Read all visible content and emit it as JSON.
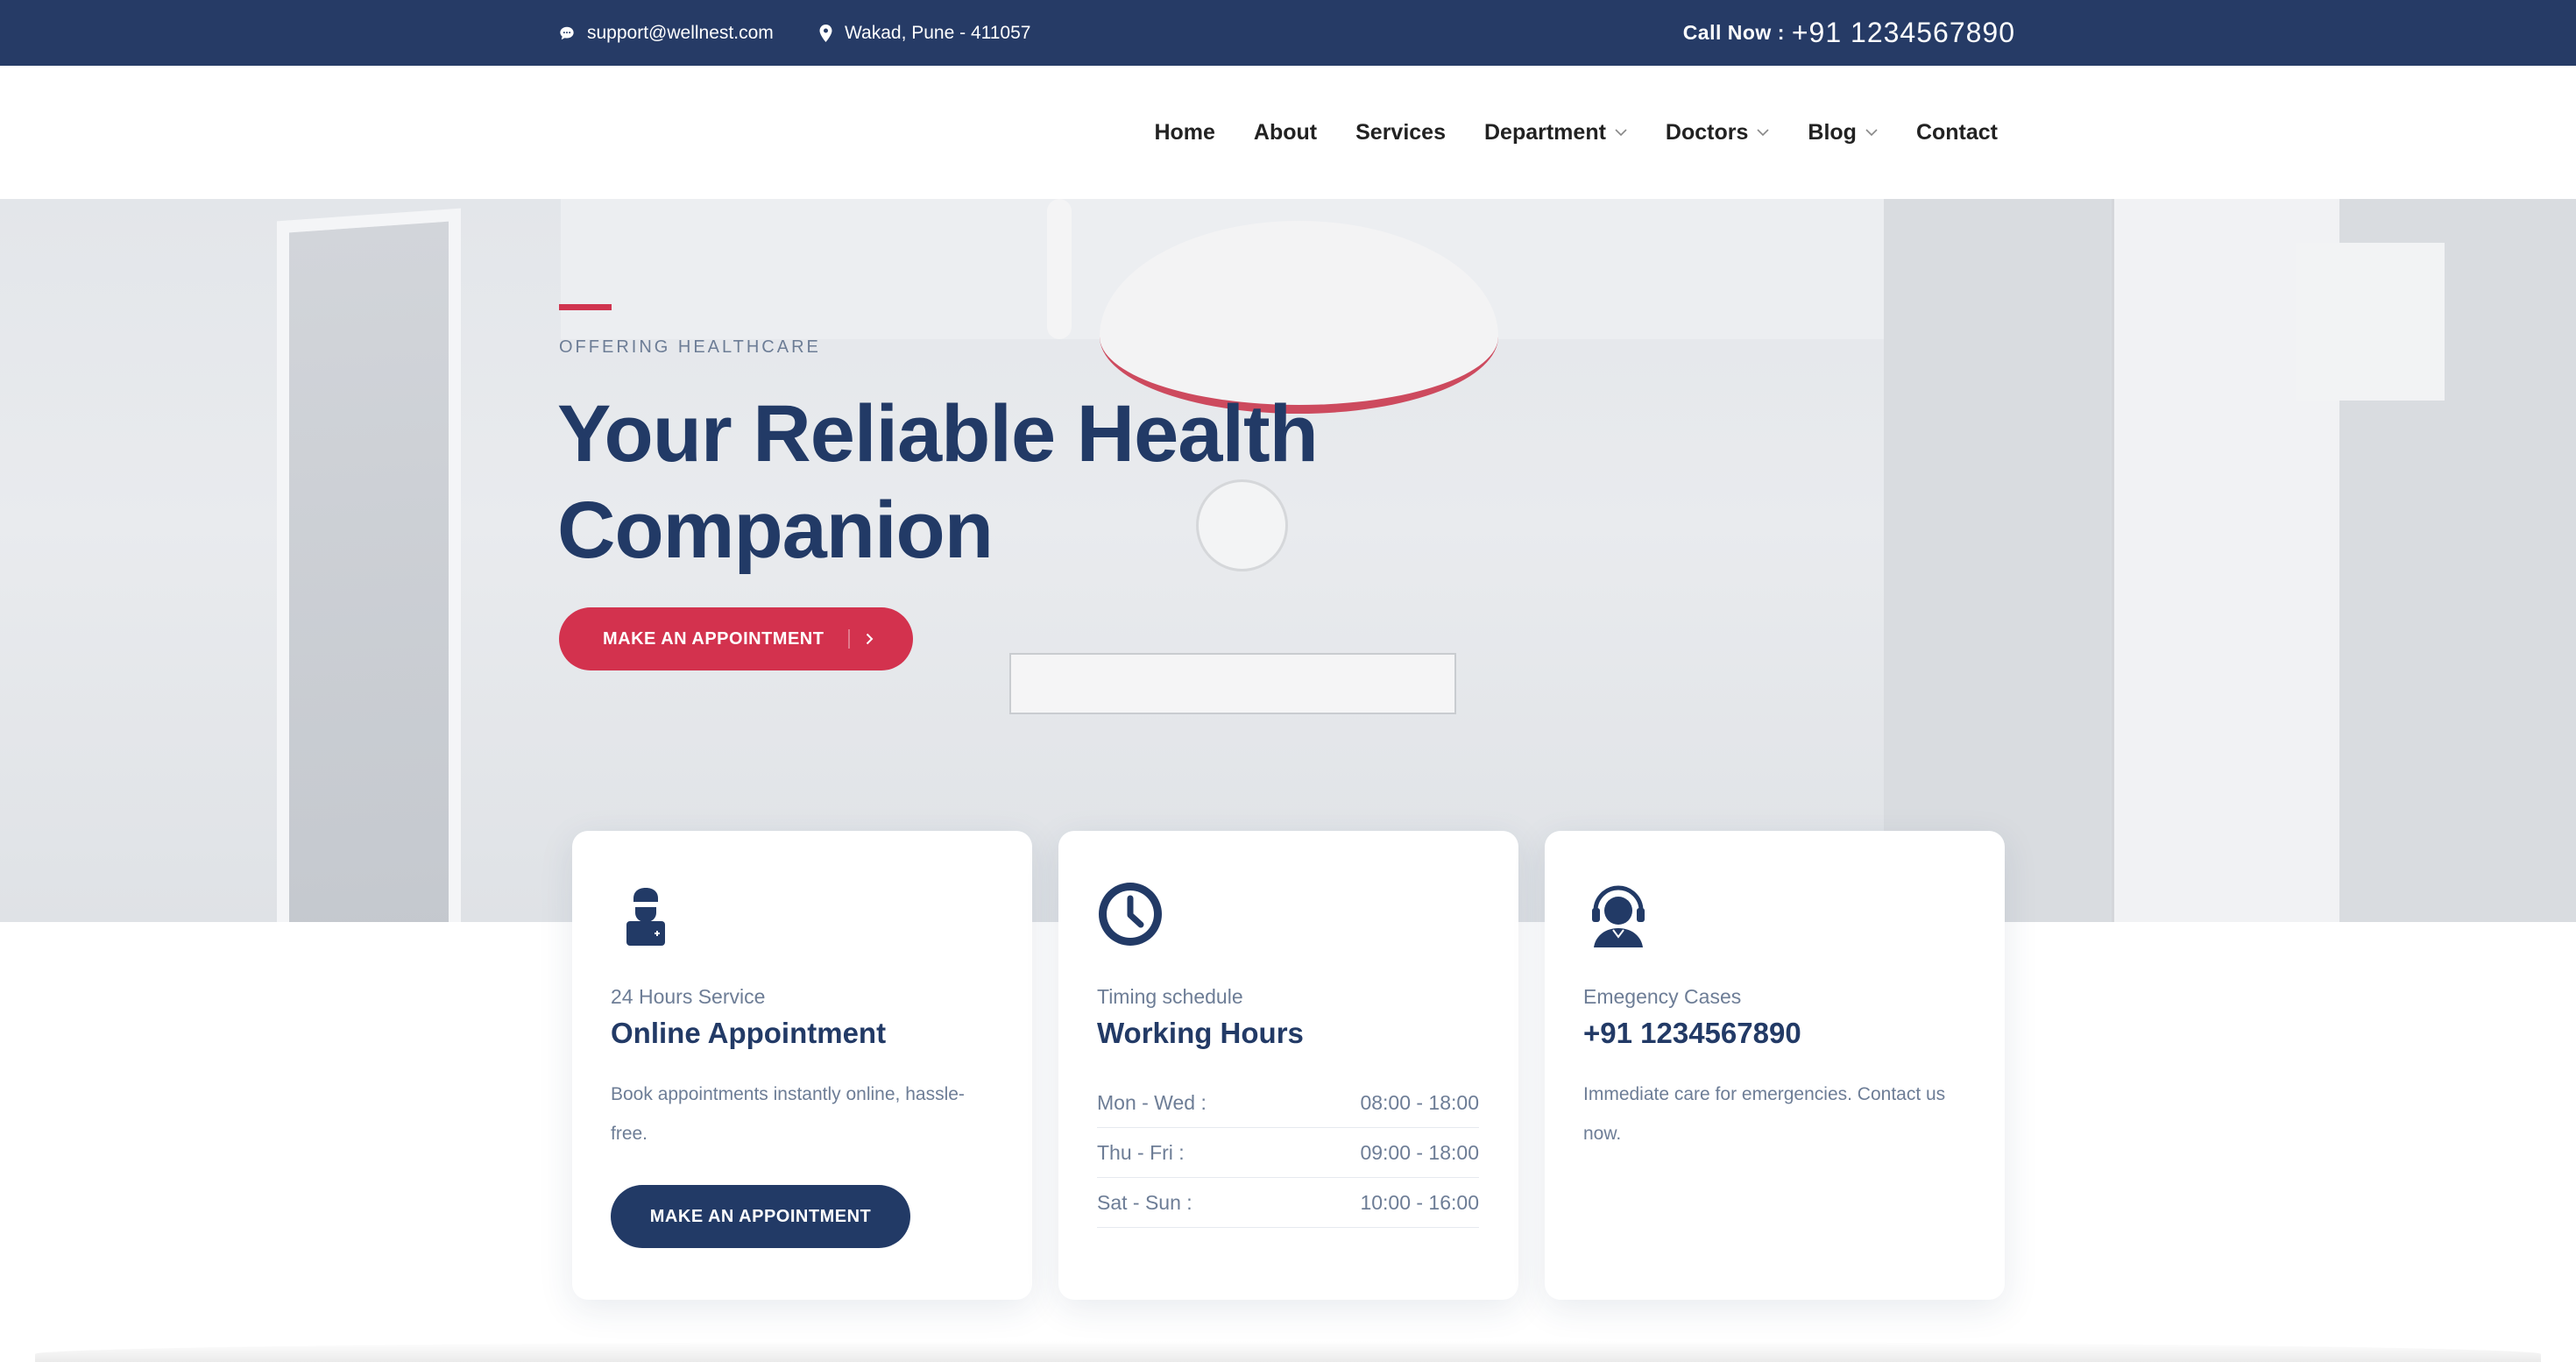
{
  "topbar": {
    "email": "support@wellnest.com",
    "address": "Wakad, Pune - 411057",
    "call_label": "Call Now :",
    "call_number": "+91 1234567890"
  },
  "nav": {
    "items": [
      {
        "label": "Home"
      },
      {
        "label": "About"
      },
      {
        "label": "Services"
      },
      {
        "label": "Department",
        "dropdown": true
      },
      {
        "label": "Doctors",
        "dropdown": true
      },
      {
        "label": "Blog",
        "dropdown": true
      },
      {
        "label": "Contact"
      }
    ]
  },
  "hero": {
    "kicker": "OFFERING HEALTHCARE",
    "title_line1": "Your Reliable Health",
    "title_line2": "Companion",
    "cta": "MAKE AN APPOINTMENT"
  },
  "cards": {
    "appointment": {
      "icon": "doctor-icon",
      "subtitle": "24 Hours Service",
      "title": "Online Appointment",
      "description": "Book appointments instantly online, hassle-free.",
      "button": "MAKE AN APPOINTMENT"
    },
    "hours": {
      "icon": "clock-icon",
      "subtitle": "Timing schedule",
      "title": "Working Hours",
      "rows": [
        {
          "day": "Mon - Wed :",
          "time": "08:00 - 18:00"
        },
        {
          "day": "Thu - Fri :",
          "time": "09:00 - 18:00"
        },
        {
          "day": "Sat - Sun :",
          "time": "10:00 - 16:00"
        }
      ]
    },
    "emergency": {
      "icon": "headset-support-icon",
      "subtitle": "Emegency Cases",
      "title": "+91 1234567890",
      "description": "Immediate care for emergencies. Contact us now."
    }
  },
  "colors": {
    "navy": "#223a66",
    "topbar": "#263b66",
    "accent_red": "#d3324e",
    "muted_text": "#6d7d96"
  }
}
